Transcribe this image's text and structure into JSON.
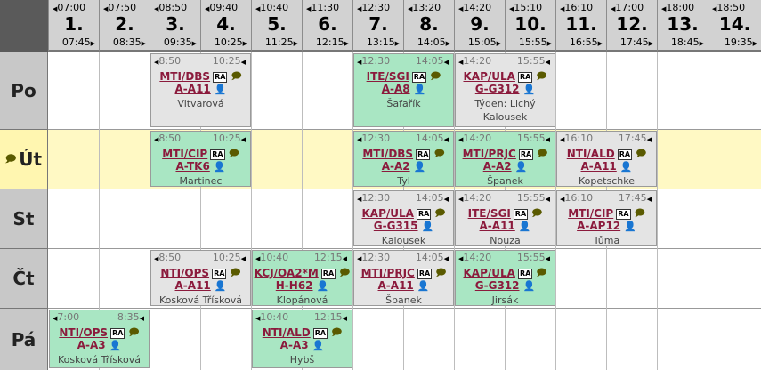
{
  "headers": [
    {
      "start": "07:00",
      "num": "1.",
      "end": "07:45"
    },
    {
      "start": "07:50",
      "num": "2.",
      "end": "08:35"
    },
    {
      "start": "08:50",
      "num": "3.",
      "end": "09:35"
    },
    {
      "start": "09:40",
      "num": "4.",
      "end": "10:25"
    },
    {
      "start": "10:40",
      "num": "5.",
      "end": "11:25"
    },
    {
      "start": "11:30",
      "num": "6.",
      "end": "12:15"
    },
    {
      "start": "12:30",
      "num": "7.",
      "end": "13:15"
    },
    {
      "start": "13:20",
      "num": "8.",
      "end": "14:05"
    },
    {
      "start": "14:20",
      "num": "9.",
      "end": "15:05"
    },
    {
      "start": "15:10",
      "num": "10.",
      "end": "15:55"
    },
    {
      "start": "16:10",
      "num": "11.",
      "end": "16:55"
    },
    {
      "start": "17:00",
      "num": "12.",
      "end": "17:45"
    },
    {
      "start": "18:00",
      "num": "13.",
      "end": "18:45"
    },
    {
      "start": "18:50",
      "num": "14.",
      "end": "19:35"
    }
  ],
  "days": [
    "Po",
    "Út",
    "St",
    "Čt",
    "Pá"
  ],
  "ra_label": "RA",
  "cards": [
    {
      "day": 0,
      "period": 2,
      "span": 2,
      "color": "grey",
      "ts": "8:50",
      "te": "10:25",
      "subj": "MTI/DBS",
      "room": "A-A11",
      "teacher": "Vitvarová"
    },
    {
      "day": 0,
      "period": 6,
      "span": 2,
      "color": "green",
      "ts": "12:30",
      "te": "14:05",
      "subj": "ITE/SGI",
      "room": "A-A8",
      "teacher": "Šafařík"
    },
    {
      "day": 0,
      "period": 8,
      "span": 2,
      "color": "grey",
      "ts": "14:20",
      "te": "15:55",
      "subj": "KAP/ULA",
      "room": "G-G312",
      "week": "Týden: Lichý",
      "teacher": "Kalousek"
    },
    {
      "day": 1,
      "period": 2,
      "span": 2,
      "color": "green",
      "ts": "8:50",
      "te": "10:25",
      "subj": "MTI/CIP",
      "room": "A-TK6",
      "teacher": "Martinec"
    },
    {
      "day": 1,
      "period": 6,
      "span": 2,
      "color": "green",
      "ts": "12:30",
      "te": "14:05",
      "subj": "MTI/DBS",
      "room": "A-A2",
      "teacher": "Tyl"
    },
    {
      "day": 1,
      "period": 8,
      "span": 2,
      "color": "green",
      "ts": "14:20",
      "te": "15:55",
      "subj": "MTI/PRJC",
      "room": "A-A2",
      "teacher": "Španek"
    },
    {
      "day": 1,
      "period": 10,
      "span": 2,
      "color": "grey",
      "ts": "16:10",
      "te": "17:45",
      "subj": "NTI/ALD",
      "room": "A-A11",
      "teacher": "Kopetschke"
    },
    {
      "day": 2,
      "period": 6,
      "span": 2,
      "color": "grey",
      "ts": "12:30",
      "te": "14:05",
      "subj": "KAP/ULA",
      "room": "G-G315",
      "teacher": "Kalousek"
    },
    {
      "day": 2,
      "period": 8,
      "span": 2,
      "color": "grey",
      "ts": "14:20",
      "te": "15:55",
      "subj": "ITE/SGI",
      "room": "A-A11",
      "teacher": "Nouza"
    },
    {
      "day": 2,
      "period": 10,
      "span": 2,
      "color": "grey",
      "ts": "16:10",
      "te": "17:45",
      "subj": "MTI/CIP",
      "room": "A-AP12",
      "teacher": "Tůma"
    },
    {
      "day": 3,
      "period": 2,
      "span": 2,
      "color": "grey",
      "ts": "8:50",
      "te": "10:25",
      "subj": "NTI/OPS",
      "room": "A-A11",
      "teacher": "Kosková Třísková"
    },
    {
      "day": 3,
      "period": 4,
      "span": 2,
      "color": "green",
      "ts": "10:40",
      "te": "12:15",
      "subj": "KCJ/OA2*M",
      "room": "H-H62",
      "teacher": "Klopánová"
    },
    {
      "day": 3,
      "period": 6,
      "span": 2,
      "color": "grey",
      "ts": "12:30",
      "te": "14:05",
      "subj": "MTI/PRJC",
      "room": "A-A11",
      "teacher": "Španek"
    },
    {
      "day": 3,
      "period": 8,
      "span": 2,
      "color": "green",
      "ts": "14:20",
      "te": "15:55",
      "subj": "KAP/ULA",
      "room": "G-G312",
      "teacher": "Jirsák"
    },
    {
      "day": 4,
      "period": 0,
      "span": 2,
      "color": "green",
      "ts": "7:00",
      "te": "8:35",
      "subj": "NTI/OPS",
      "room": "A-A3",
      "teacher": "Kosková Třísková"
    },
    {
      "day": 4,
      "period": 4,
      "span": 2,
      "color": "green",
      "ts": "10:40",
      "te": "12:15",
      "subj": "NTI/ALD",
      "room": "A-A3",
      "teacher": "Hybš"
    }
  ]
}
